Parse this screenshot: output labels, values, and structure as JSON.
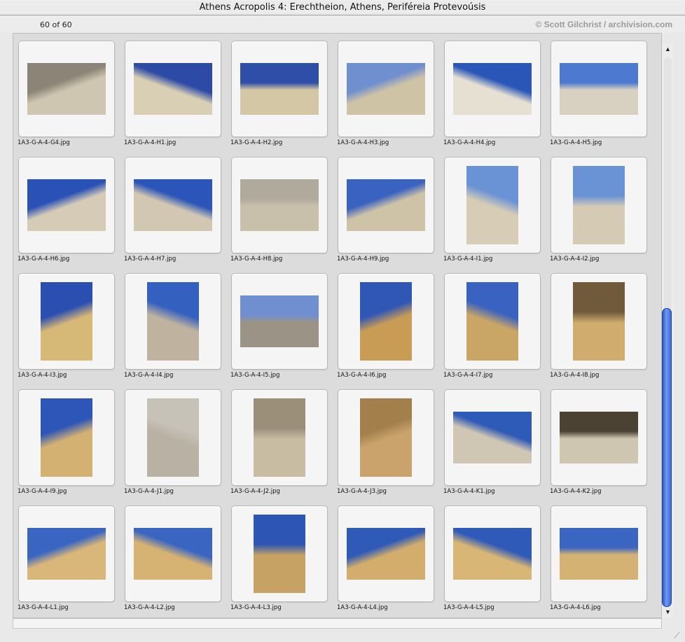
{
  "window": {
    "title": "Athens Acropolis 4: Erechtheion, Athens, Periféreia Protevoúsis"
  },
  "toolbar": {
    "count_label": "60 of 60",
    "credit": "© Scott Gilchrist / archivision.com"
  },
  "scrollbar": {
    "up_glyph": "▲",
    "down_glyph": "▼",
    "position_fraction": 0.47
  },
  "grip_glyph": "⟋",
  "thumbnails": [
    {
      "file": "1A3-G-A-4-G4.jpg",
      "orientation": "land",
      "sky": "#8c8577",
      "stone": "#cfc6b2"
    },
    {
      "file": "1A3-G-A-4-H1.jpg",
      "orientation": "land",
      "sky": "#2c4aa6",
      "stone": "#d9cfb4"
    },
    {
      "file": "1A3-G-A-4-H2.jpg",
      "orientation": "land",
      "sky": "#2f4ea8",
      "stone": "#d4c7a6"
    },
    {
      "file": "1A3-G-A-4-H3.jpg",
      "orientation": "land",
      "sky": "#6f8fcf",
      "stone": "#cfc3a6"
    },
    {
      "file": "1A3-G-A-4-H4.jpg",
      "orientation": "land",
      "sky": "#2a56b8",
      "stone": "#e6e0d2"
    },
    {
      "file": "1A3-G-A-4-H5.jpg",
      "orientation": "land",
      "sky": "#4d7ad0",
      "stone": "#d8d1c2"
    },
    {
      "file": "1A3-G-A-4-H6.jpg",
      "orientation": "land",
      "sky": "#2a52b6",
      "stone": "#d6cbb6"
    },
    {
      "file": "1A3-G-A-4-H7.jpg",
      "orientation": "land",
      "sky": "#2b55b8",
      "stone": "#d1c7b2"
    },
    {
      "file": "1A3-G-A-4-H8.jpg",
      "orientation": "land",
      "sky": "#b0aa9c",
      "stone": "#c9c0ab"
    },
    {
      "file": "1A3-G-A-4-H9.jpg",
      "orientation": "land",
      "sky": "#3a62c0",
      "stone": "#cfc3a7"
    },
    {
      "file": "1A3-G-A-4-I1.jpg",
      "orientation": "port",
      "sky": "#6a93d6",
      "stone": "#d7cdb6"
    },
    {
      "file": "1A3-G-A-4-I2.jpg",
      "orientation": "port",
      "sky": "#6a93d6",
      "stone": "#d5cbb5"
    },
    {
      "file": "1A3-G-A-4-I3.jpg",
      "orientation": "port",
      "sky": "#2b4fb0",
      "stone": "#d6b877"
    },
    {
      "file": "1A3-G-A-4-I4.jpg",
      "orientation": "port",
      "sky": "#3460bf",
      "stone": "#bfb3a0"
    },
    {
      "file": "1A3-G-A-4-I5.jpg",
      "orientation": "land",
      "sky": "#6f8fd1",
      "stone": "#9b9386"
    },
    {
      "file": "1A3-G-A-4-I6.jpg",
      "orientation": "port",
      "sky": "#3057b6",
      "stone": "#c99c55"
    },
    {
      "file": "1A3-G-A-4-I7.jpg",
      "orientation": "port",
      "sky": "#3a62c0",
      "stone": "#c9a666"
    },
    {
      "file": "1A3-G-A-4-I8.jpg",
      "orientation": "port",
      "sky": "#6f5b3c",
      "stone": "#d0ad6e"
    },
    {
      "file": "1A3-G-A-4-I9.jpg",
      "orientation": "port",
      "sky": "#2d56b8",
      "stone": "#d3b173"
    },
    {
      "file": "1A3-G-A-4-J1.jpg",
      "orientation": "port",
      "sky": "#c6c2b8",
      "stone": "#b9b2a4"
    },
    {
      "file": "1A3-G-A-4-J2.jpg",
      "orientation": "port",
      "sky": "#9b8f79",
      "stone": "#c8bca3"
    },
    {
      "file": "1A3-G-A-4-J3.jpg",
      "orientation": "port",
      "sky": "#a27f4b",
      "stone": "#c9a36b"
    },
    {
      "file": "1A3-G-A-4-K1.jpg",
      "orientation": "land",
      "sky": "#2e5ab8",
      "stone": "#cfc6b3"
    },
    {
      "file": "1A3-G-A-4-K2.jpg",
      "orientation": "land",
      "sky": "#4b4234",
      "stone": "#cfc6b1"
    },
    {
      "file": "1A3-G-A-4-L1.jpg",
      "orientation": "land",
      "sky": "#3a66c2",
      "stone": "#d9b679"
    },
    {
      "file": "1A3-G-A-4-L2.jpg",
      "orientation": "land",
      "sky": "#3a66c2",
      "stone": "#d6b273"
    },
    {
      "file": "1A3-G-A-4-L3.jpg",
      "orientation": "port",
      "sky": "#2c55b4",
      "stone": "#c7a265"
    },
    {
      "file": "1A3-G-A-4-L4.jpg",
      "orientation": "land",
      "sky": "#2f5ab8",
      "stone": "#d2ad6c"
    },
    {
      "file": "1A3-G-A-4-L5.jpg",
      "orientation": "land",
      "sky": "#2f5ab8",
      "stone": "#d7b676"
    },
    {
      "file": "1A3-G-A-4-L6.jpg",
      "orientation": "land",
      "sky": "#3a66c2",
      "stone": "#d3b274"
    }
  ]
}
